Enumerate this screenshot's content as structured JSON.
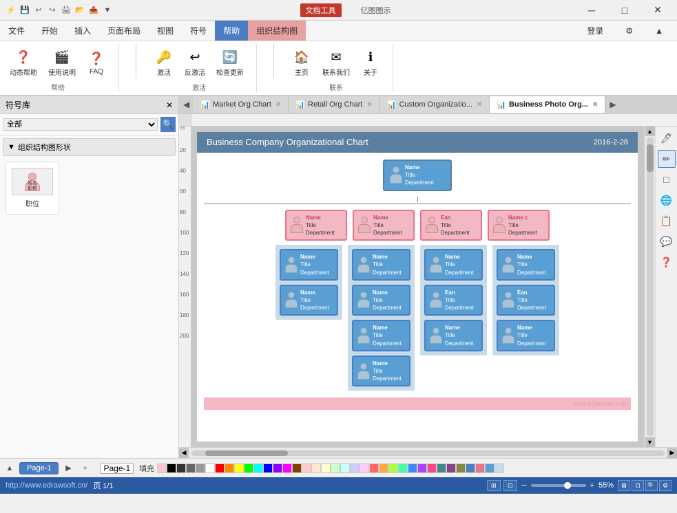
{
  "window": {
    "title_left": "文档工具",
    "title_right": "亿图图示",
    "min_btn": "─",
    "max_btn": "□",
    "close_btn": "✕"
  },
  "menu": {
    "items": [
      "文件",
      "开始",
      "插入",
      "页面布局",
      "视图",
      "符号",
      "帮助",
      "组织结构图"
    ],
    "right_items": [
      "登录",
      "⚙"
    ]
  },
  "ribbon": {
    "groups": [
      {
        "label": "帮助",
        "buttons": [
          {
            "icon": "❓",
            "label": "动态帮助"
          },
          {
            "icon": "🎬",
            "label": "使用说明"
          },
          {
            "icon": "❓",
            "label": "FAQ"
          }
        ]
      },
      {
        "label": "激活",
        "buttons": [
          {
            "icon": "🔑",
            "label": "激活"
          },
          {
            "icon": "↩",
            "label": "反激活"
          },
          {
            "icon": "🔄",
            "label": "检查更新"
          }
        ]
      },
      {
        "label": "联系",
        "buttons": [
          {
            "icon": "🏠",
            "label": "主页"
          },
          {
            "icon": "✉",
            "label": "联系我们"
          },
          {
            "icon": "ℹ",
            "label": "关于"
          }
        ]
      }
    ]
  },
  "symbol_lib": {
    "title": "符号库",
    "search_placeholder": "",
    "section_title": "组织结构图形状",
    "symbol_label": "职位"
  },
  "doc_tabs": [
    {
      "label": "Market Org Chart",
      "active": false
    },
    {
      "label": "Retail Org Chart",
      "active": false
    },
    {
      "label": "Custom Organizatio...",
      "active": false
    },
    {
      "label": "Business Photo Org...",
      "active": true
    }
  ],
  "chart": {
    "title": "Business Company Organizational Chart",
    "date": "2016-2-28",
    "watermark": "www.edrawsoft.com",
    "top_node": {
      "name": "Name",
      "title": "Title",
      "dept": "Department"
    },
    "level2": [
      {
        "name": "Name",
        "title": "Title",
        "dept": "Department"
      },
      {
        "name": "Name",
        "title": "Title",
        "dept": "Department"
      },
      {
        "name": "Ean",
        "title": "Title",
        "dept": "Department"
      },
      {
        "name": "Name c",
        "title": "Title",
        "dept": "Department"
      }
    ],
    "level3_col1": [
      {
        "name": "Name",
        "title": "Title",
        "dept": "Department"
      },
      {
        "name": "Name",
        "title": "Title",
        "dept": "Department"
      }
    ],
    "level3_col2": [
      {
        "name": "Name",
        "title": "Title",
        "dept": "Department"
      },
      {
        "name": "Name",
        "title": "Title",
        "dept": "Department"
      },
      {
        "name": "Name",
        "title": "Title",
        "dept": "Department"
      },
      {
        "name": "Name",
        "title": "Title",
        "dept": "Department"
      }
    ],
    "level3_col3": [
      {
        "name": "Name",
        "title": "Title",
        "dept": "Department"
      },
      {
        "name": "Ean",
        "title": "Title",
        "dept": "Department"
      },
      {
        "name": "Name",
        "title": "Title",
        "dept": "Department"
      }
    ],
    "level3_col4": [
      {
        "name": "Name",
        "title": "Title",
        "dept": "Department"
      },
      {
        "name": "Ean",
        "title": "Title",
        "dept": "Department"
      },
      {
        "name": "Name",
        "title": "Title",
        "dept": "Department"
      }
    ]
  },
  "right_tools": [
    "🖊",
    "✏",
    "□",
    "🌐",
    "📋",
    "💬",
    "❓"
  ],
  "bottom": {
    "fill_label": "填充",
    "page_tabs": [
      "Page-1"
    ],
    "active_page": "Page-1"
  },
  "status_bar": {
    "url": "http://www.edrawsoft.cn/",
    "page_info": "页 1/1",
    "zoom": "55%"
  },
  "colors": {
    "accent_blue": "#4a7dc4",
    "accent_pink": "#e8738a",
    "node_blue_bg": "#5a9fd4",
    "node_pink_bg": "#f4b8c4",
    "header_bg": "#5a7fa0",
    "status_bar_bg": "#2c5aa0"
  }
}
